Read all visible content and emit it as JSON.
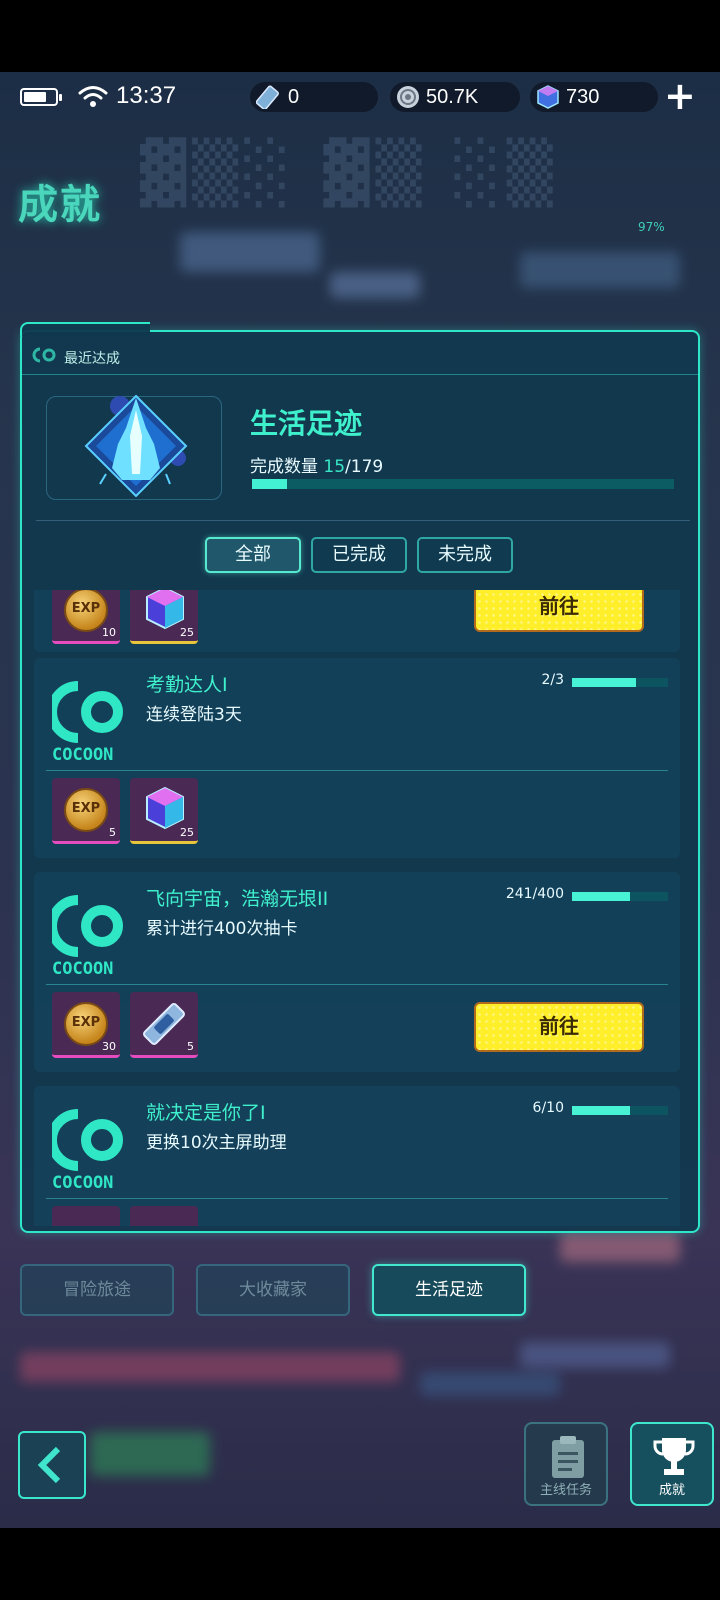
{
  "status_bar": {
    "time": "13:37",
    "currencies": [
      {
        "icon": "ticket-icon",
        "value": "0"
      },
      {
        "icon": "coin-icon",
        "value": "50.7K"
      },
      {
        "icon": "gem-cube-icon",
        "value": "730"
      }
    ],
    "add_label": "+"
  },
  "header": {
    "title": "成就",
    "progress_text": "97%"
  },
  "recent": {
    "label": "最近达成",
    "achievement_title": "生活足迹",
    "count_label": "完成数量",
    "count_current": "15",
    "count_total": "/179",
    "progress_fraction": 0.084
  },
  "filters": [
    {
      "label": "全部",
      "active": true
    },
    {
      "label": "已完成",
      "active": false
    },
    {
      "label": "未完成",
      "active": false
    }
  ],
  "cards": [
    {
      "partial": true,
      "rewards": [
        {
          "type": "exp",
          "qty": "10"
        },
        {
          "type": "cube",
          "qty": "25"
        }
      ],
      "action": "前往"
    },
    {
      "title": "考勤达人I",
      "desc": "连续登陆3天",
      "progress": "2/3",
      "progress_fraction": 0.667,
      "rewards": [
        {
          "type": "exp",
          "qty": "5"
        },
        {
          "type": "cube",
          "qty": "25"
        }
      ]
    },
    {
      "title": "飞向宇宙，浩瀚无垠II",
      "desc": "累计进行400次抽卡",
      "progress": "241/400",
      "progress_fraction": 0.6025,
      "rewards": [
        {
          "type": "exp",
          "qty": "30"
        },
        {
          "type": "ticket",
          "qty": "5"
        }
      ],
      "action": "前往"
    },
    {
      "title": "就决定是你了I",
      "desc": "更换10次主屏助理",
      "progress": "6/10",
      "progress_fraction": 0.6
    }
  ],
  "logo_text": "COCOON",
  "exp_text": "EXP",
  "categories": [
    {
      "label": "冒险旅途",
      "active": false
    },
    {
      "label": "大收藏家",
      "active": false
    },
    {
      "label": "生活足迹",
      "active": true
    }
  ],
  "bottom_nav": [
    {
      "label": "主线任务",
      "icon": "clipboard-icon",
      "active": false
    },
    {
      "label": "成就",
      "icon": "trophy-icon",
      "active": true
    }
  ],
  "colors": {
    "accent": "#3ff0cc",
    "panel": "#10384e",
    "button_yellow": "#ffef2a"
  }
}
